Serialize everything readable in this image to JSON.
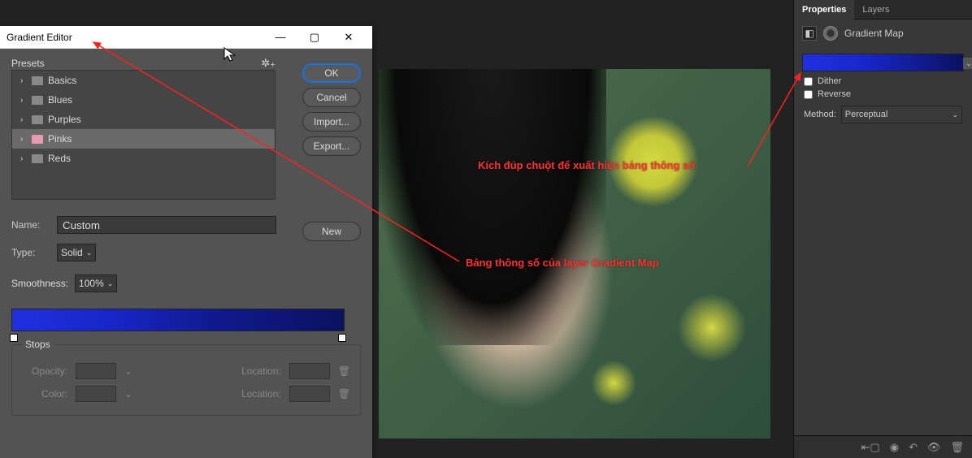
{
  "dialog": {
    "title": "Gradient Editor",
    "presets_label": "Presets",
    "presets": [
      {
        "label": "Basics"
      },
      {
        "label": "Blues"
      },
      {
        "label": "Purples"
      },
      {
        "label": "Pinks"
      },
      {
        "label": "Reds"
      }
    ],
    "selected_preset_index": 3,
    "buttons": {
      "ok": "OK",
      "cancel": "Cancel",
      "import": "Import...",
      "export": "Export...",
      "new": "New"
    },
    "name_label": "Name:",
    "name_value": "Custom",
    "type_label": "Type:",
    "type_value": "Solid",
    "smoothness_label": "Smoothness:",
    "smoothness_value": "100%",
    "stops_label": "Stops",
    "opacity_label": "Opacity:",
    "location_label": "Location:",
    "color_label": "Color:"
  },
  "panel": {
    "tabs": {
      "properties": "Properties",
      "layers": "Layers"
    },
    "layer_type": "Gradient Map",
    "dither": "Dither",
    "reverse": "Reverse",
    "method_label": "Method:",
    "method_value": "Perceptual"
  },
  "annotations": {
    "a1": "Kích đúp chuột để xuất hiện bảng thông số",
    "a2": "Bảng thông số của layer Gradient Map"
  },
  "chart_data": {
    "type": "other",
    "gradient_stops": [
      {
        "pos": 0,
        "color": "#2030e0"
      },
      {
        "pos": 100,
        "color": "#0a1260"
      }
    ],
    "smoothness_pct": 100
  }
}
